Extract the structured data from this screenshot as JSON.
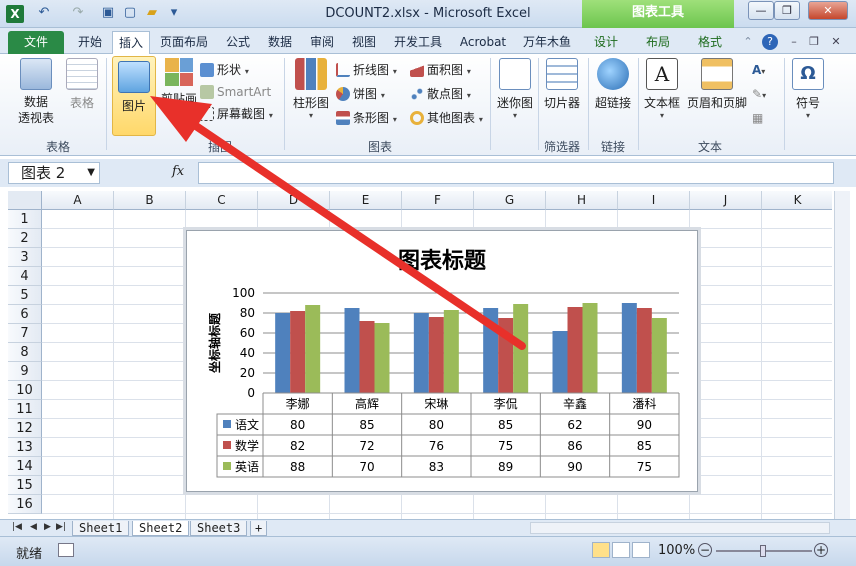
{
  "window": {
    "title": "DCOUNT2.xlsx - Microsoft Excel",
    "context_title": "图表工具",
    "minimize": "—",
    "restore": "❐",
    "close": "✕"
  },
  "tabs": [
    {
      "id": "file",
      "label": "文件"
    },
    {
      "id": "home",
      "label": "开始"
    },
    {
      "id": "insert",
      "label": "插入"
    },
    {
      "id": "page-layout",
      "label": "页面布局"
    },
    {
      "id": "formulas",
      "label": "公式"
    },
    {
      "id": "data",
      "label": "数据"
    },
    {
      "id": "review",
      "label": "审阅"
    },
    {
      "id": "view",
      "label": "视图"
    },
    {
      "id": "developer",
      "label": "开发工具"
    },
    {
      "id": "acrobat",
      "label": "Acrobat"
    },
    {
      "id": "wanhe",
      "label": "万年木鱼"
    },
    {
      "id": "design",
      "label": "设计"
    },
    {
      "id": "layout",
      "label": "布局"
    },
    {
      "id": "format",
      "label": "格式"
    }
  ],
  "ribbon": {
    "tables": {
      "pivot": "数据\n透视表",
      "table": "表格",
      "group": "表格"
    },
    "illustrations": {
      "picture": "图片",
      "clipart": "剪贴画",
      "shapes": "形状",
      "smartart": "SmartArt",
      "screenshot": "屏幕截图",
      "group": "插图"
    },
    "charts": {
      "column": "柱形图",
      "line": "折线图",
      "pie": "饼图",
      "bar": "条形图",
      "area": "面积图",
      "scatter": "散点图",
      "other": "其他图表",
      "group": "图表"
    },
    "sparklines": {
      "label": "迷你图"
    },
    "filter": {
      "slicer": "切片器",
      "group": "筛选器"
    },
    "links": {
      "hyperlink": "超链接",
      "group": "链接"
    },
    "text": {
      "textbox": "文本框",
      "header_footer": "页眉和页脚",
      "group": "文本"
    },
    "symbols": {
      "symbol": "符号"
    }
  },
  "formula_bar": {
    "name_box": "图表 2",
    "fx": "fx",
    "value": ""
  },
  "columns": [
    "A",
    "B",
    "C",
    "D",
    "E",
    "F",
    "G",
    "H",
    "I",
    "J",
    "K"
  ],
  "rows": [
    "1",
    "2",
    "3",
    "4",
    "5",
    "6",
    "7",
    "8",
    "9",
    "10",
    "11",
    "12",
    "13",
    "14",
    "15",
    "16"
  ],
  "sheets": [
    "Sheet1",
    "Sheet2",
    "Sheet3"
  ],
  "status": {
    "ready": "就绪",
    "zoom": "100%"
  },
  "colors": {
    "blue": "#4f81bd",
    "red": "#c0504d",
    "green": "#9bbb59"
  },
  "chart_data": {
    "type": "bar",
    "title": "图表标题",
    "ylabel": "坐标轴标题",
    "xlabel": "",
    "ylim": [
      0,
      100
    ],
    "yticks": [
      0,
      20,
      40,
      60,
      80,
      100
    ],
    "categories": [
      "李娜",
      "高辉",
      "宋琳",
      "李侃",
      "辛鑫",
      "潘科"
    ],
    "series": [
      {
        "name": "语文",
        "color": "#4f81bd",
        "values": [
          80,
          85,
          80,
          85,
          62,
          90
        ]
      },
      {
        "name": "数学",
        "color": "#c0504d",
        "values": [
          82,
          72,
          76,
          75,
          86,
          85
        ]
      },
      {
        "name": "英语",
        "color": "#9bbb59",
        "values": [
          88,
          70,
          83,
          89,
          90,
          75
        ]
      }
    ]
  }
}
